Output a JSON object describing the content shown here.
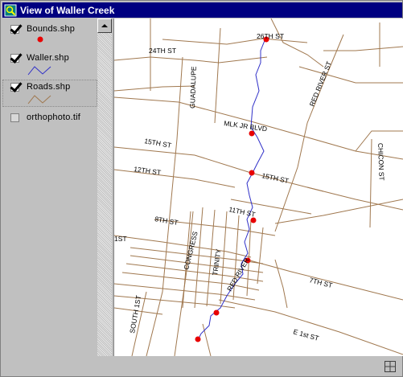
{
  "window": {
    "title": "View of Waller Creek"
  },
  "toc": {
    "layers": [
      {
        "name": "Bounds.shp",
        "checked": true,
        "legend": "point"
      },
      {
        "name": "Waller.shp",
        "checked": true,
        "legend": "line"
      },
      {
        "name": "Roads.shp",
        "checked": true,
        "legend": "line",
        "active": true
      },
      {
        "name": "orthophoto.tif",
        "checked": false,
        "legend": "none"
      }
    ]
  },
  "map": {
    "labels": {
      "st24": "24TH ST",
      "st26": "26TH ST",
      "guadalupe": "GUADALUPE",
      "red_river_n": "RED RIVER ST",
      "mlk": "MLK JR BLVD",
      "st15_w": "15TH ST",
      "st15_e": "15TH ST",
      "st12": "12TH ST",
      "chicon": "CHICON ST",
      "st11": "11TH ST",
      "st8": "8TH ST",
      "st1_left": "1ST",
      "congress": "CONGRESS",
      "trinity": "TRINITY",
      "red_river_s": "RED RIVER",
      "st7": "7TH ST",
      "south1st": "SOUTH 1ST",
      "e1st": "E 1st ST"
    },
    "colors": {
      "roads": "#a0784f",
      "creek": "#3030c8",
      "bounds": "#e80000"
    }
  }
}
